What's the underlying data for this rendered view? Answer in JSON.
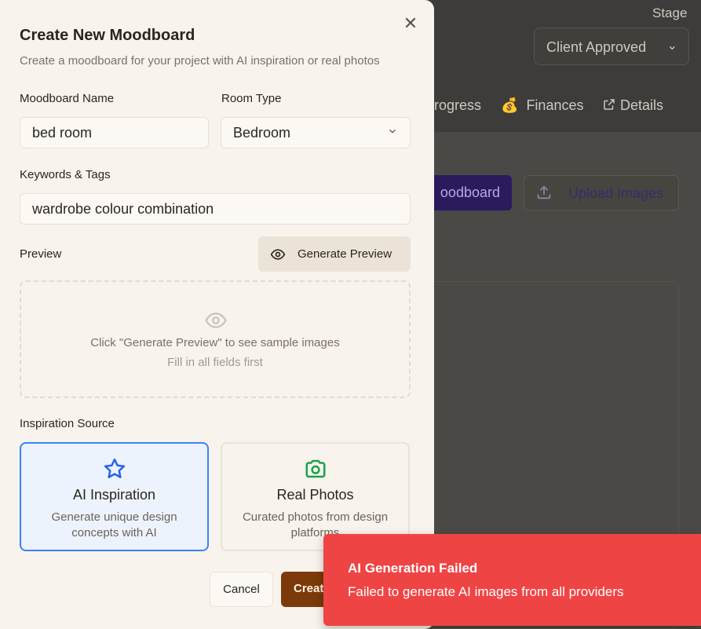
{
  "background": {
    "stage_label": "Stage",
    "stage_select_value": "Client Approved",
    "tabs": [
      {
        "icon": "",
        "label": "rogress"
      },
      {
        "icon": "money-bag-icon",
        "label": "Finances"
      },
      {
        "icon": "external-link-icon",
        "label": "Details"
      }
    ],
    "primary_button_label": "oodboard",
    "upload_button_label": "Upload Images"
  },
  "modal": {
    "title": "Create New Moodboard",
    "subtitle": "Create a moodboard for your project with AI inspiration or real photos",
    "name_label": "Moodboard Name",
    "name_value": "bed room",
    "room_type_label": "Room Type",
    "room_type_value": "Bedroom",
    "keywords_label": "Keywords & Tags",
    "keywords_value": "wardrobe colour combination",
    "preview_label": "Preview",
    "generate_preview_label": "Generate Preview",
    "preview_empty_line1": "Click \"Generate Preview\" to see sample images",
    "preview_empty_line2": "Fill in all fields first",
    "inspiration_label": "Inspiration Source",
    "options": [
      {
        "title": "AI Inspiration",
        "description": "Generate unique design concepts with AI",
        "selected": true
      },
      {
        "title": "Real Photos",
        "description": "Curated photos from design platforms",
        "selected": false
      }
    ],
    "cancel_label": "Cancel",
    "create_label": "Create Moodboard"
  },
  "toast": {
    "title": "AI Generation Failed",
    "description": "Failed to generate AI images from all providers"
  },
  "colors": {
    "modal_bg": "#f8f3ec",
    "accent_selected": "#3b82f6",
    "create_button": "#7c3a0a",
    "toast_bg": "#ef4444",
    "camera_icon": "#16a34a"
  }
}
